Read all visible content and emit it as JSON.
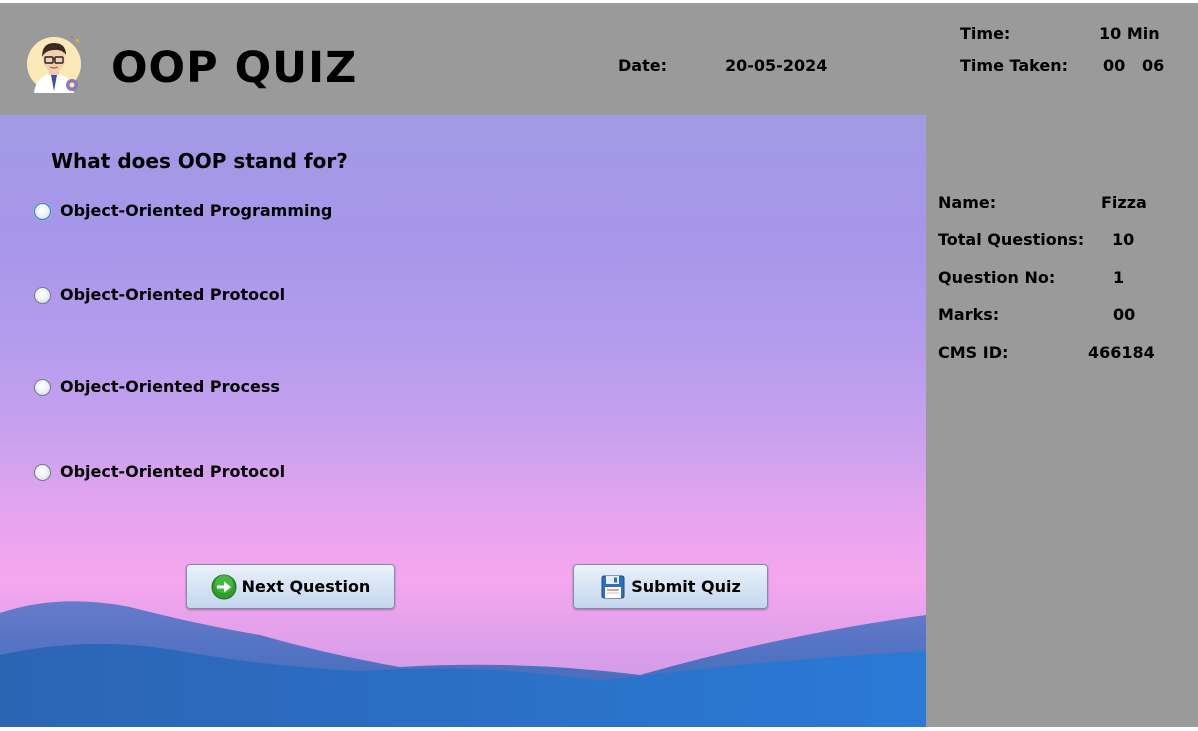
{
  "header": {
    "title": "OOP QUIZ",
    "date_label": "Date:",
    "date_value": "20-05-2024",
    "time_label": "Time:",
    "time_value": "10 Min",
    "time_taken_label": "Time Taken:",
    "time_taken_minutes": "00",
    "time_taken_seconds": "06"
  },
  "question": {
    "text": "What does OOP stand for?",
    "options": [
      "Object-Oriented Programming",
      "Object-Oriented Protocol",
      "Object-Oriented Process",
      "Object-Oriented Protocol"
    ]
  },
  "buttons": {
    "next_label": "Next Question",
    "submit_label": "Submit Quiz"
  },
  "info": {
    "name_label": "Name:",
    "name_value": "Fizza",
    "total_label": "Total Questions:",
    "total_value": "10",
    "question_no_label": "Question No:",
    "question_no_value": "1",
    "marks_label": "Marks:",
    "marks_value": "00",
    "cms_label": "CMS ID:",
    "cms_value": "466184"
  },
  "icons": {
    "avatar": "avatar-icon",
    "next": "arrow-right-icon",
    "submit": "floppy-disk-icon"
  },
  "colors": {
    "frame_bg": "#9a9a9a",
    "button_bg": "#d7e4f4",
    "next_icon": "#2e9e2e",
    "submit_icon": "#2d6fb8"
  }
}
